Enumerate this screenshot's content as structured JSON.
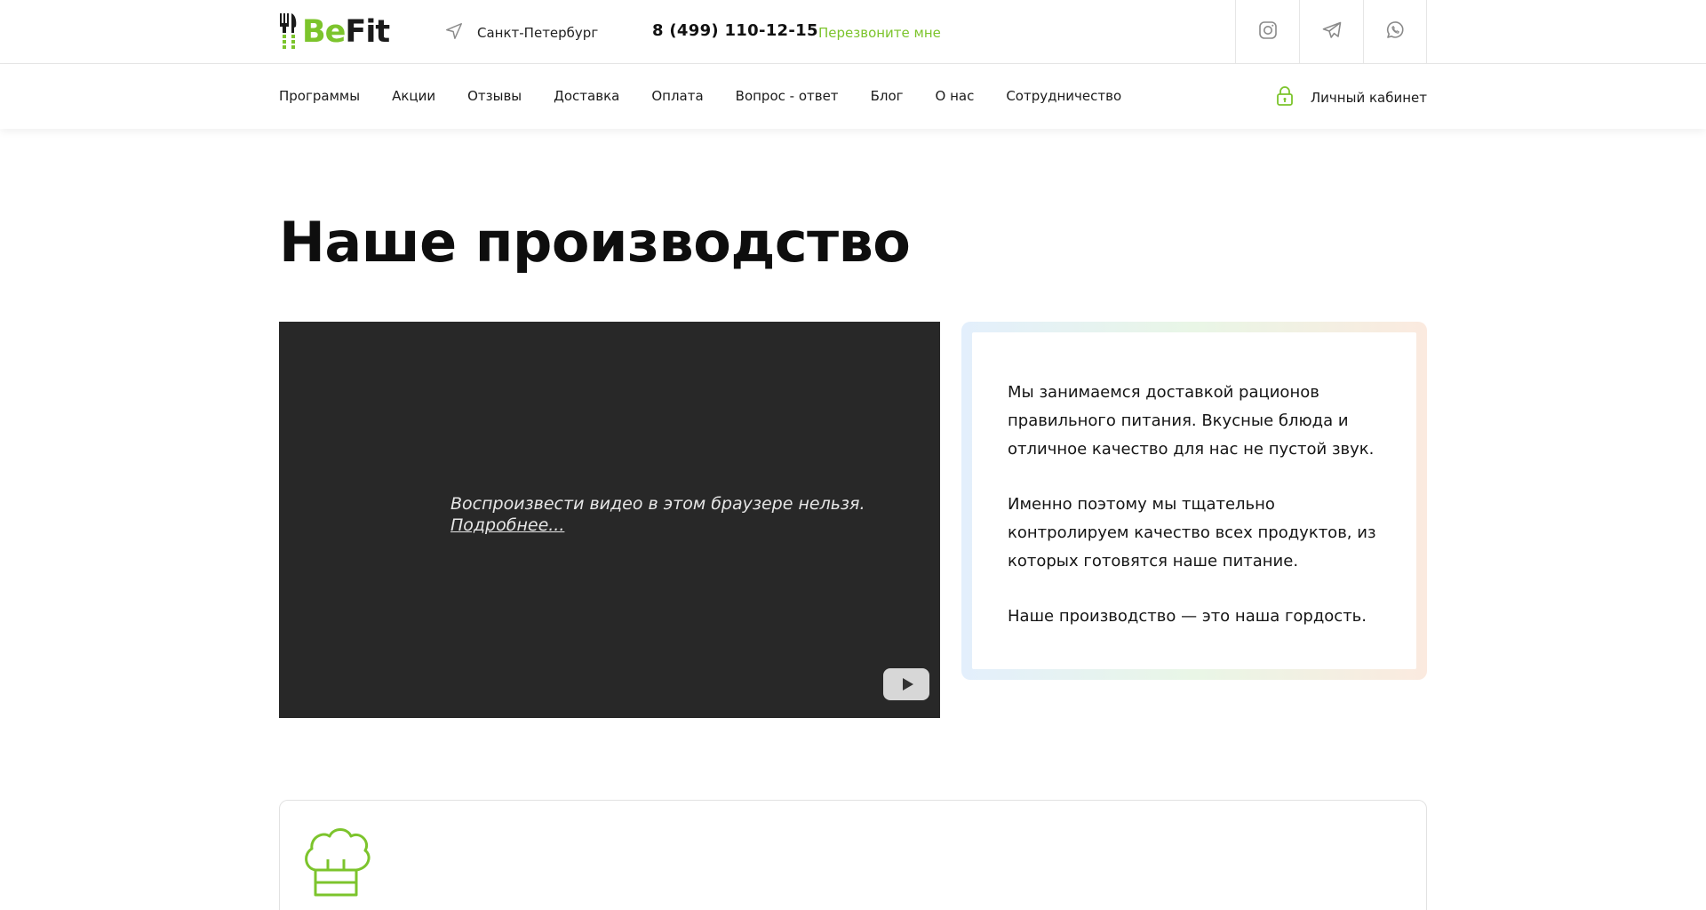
{
  "header": {
    "logo": {
      "part1": "Be",
      "part2": "Fit"
    },
    "city": "Санкт-Петербург",
    "phone": "8 (499) 110-12-15",
    "callback": "Перезвоните мне",
    "socials": [
      {
        "icon": "instagram-icon"
      },
      {
        "icon": "telegram-icon"
      },
      {
        "icon": "whatsapp-icon"
      }
    ]
  },
  "nav": {
    "items": [
      {
        "label": "Программы"
      },
      {
        "label": "Акции"
      },
      {
        "label": "Отзывы"
      },
      {
        "label": "Доставка"
      },
      {
        "label": "Оплата"
      },
      {
        "label": "Вопрос - ответ"
      },
      {
        "label": "Блог"
      },
      {
        "label": "О нас"
      },
      {
        "label": "Сотрудничество"
      }
    ],
    "cabinet": "Личный кабинет"
  },
  "page": {
    "title": "Наше производство"
  },
  "video": {
    "message": "Воспроизвести видео в этом браузере нельзя.",
    "more": "Подробнее..."
  },
  "about": {
    "paragraphs": [
      "Мы занимаемся доставкой рационов правильного питания. Вкусные блюда и отличное качество для нас не пустой звук.",
      "Именно поэтому мы тщательно контролируем качество всех продуктов, из которых готовятся наше питание.",
      "Наше производство — это наша гордость."
    ]
  },
  "colors": {
    "accent": "#7cc42c",
    "text": "#111111",
    "video_bg": "#282828"
  }
}
